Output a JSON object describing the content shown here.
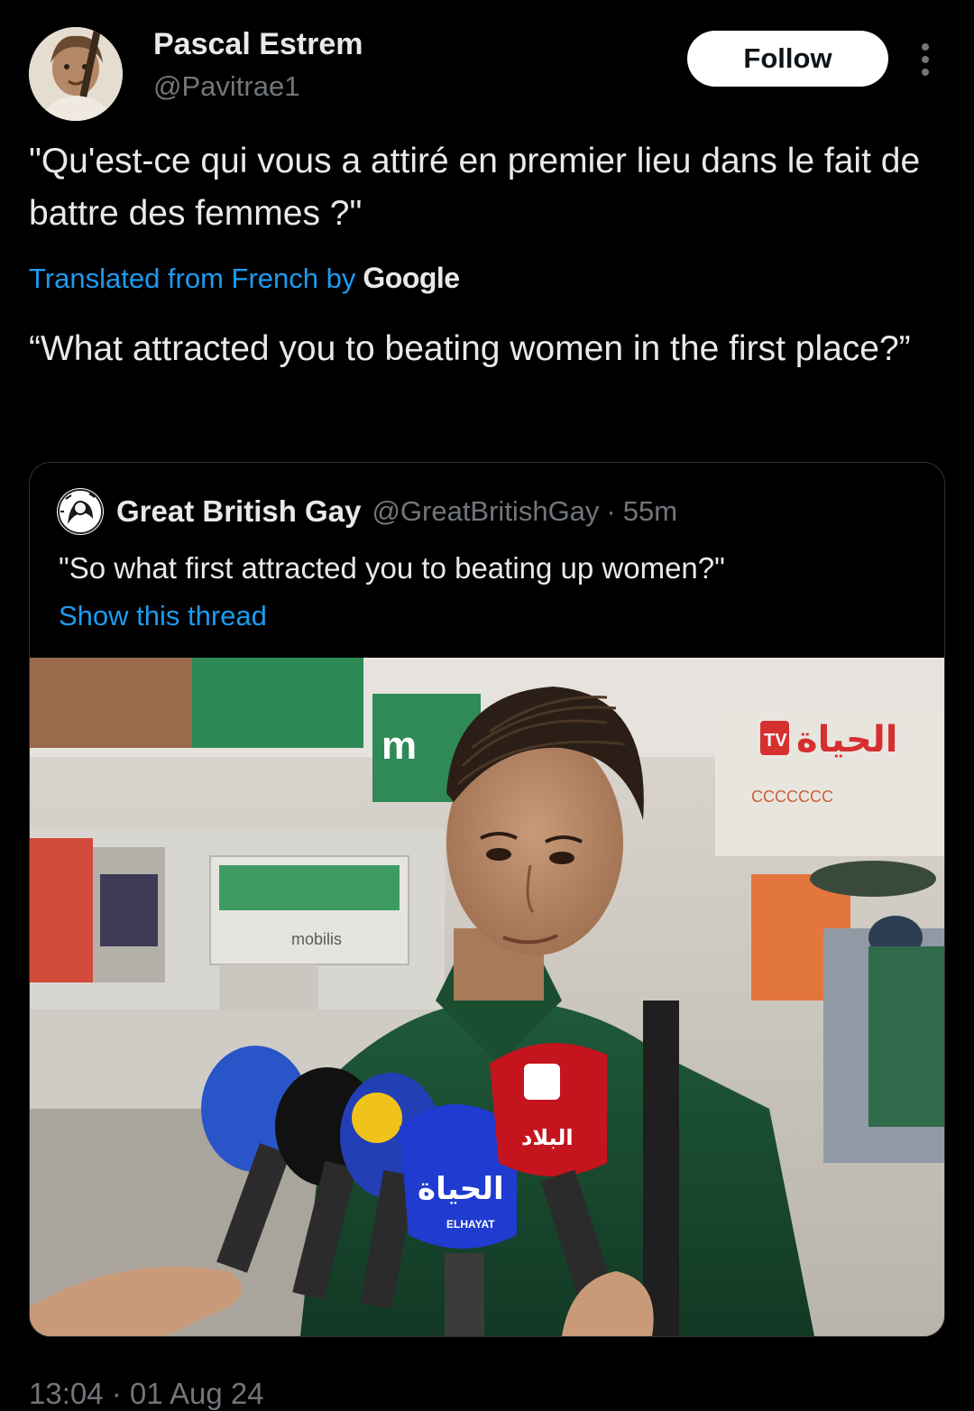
{
  "author": {
    "name": "Pascal Estrem",
    "handle": "@Pavitrae1",
    "avatar_icon": "profile-photo"
  },
  "follow_label": "Follow",
  "more_icon": "more-vertical-icon",
  "tweet": {
    "text": "\"Qu'est-ce qui vous a attiré en premier lieu dans le fait de battre des femmes ?\"",
    "translated_from": "Translated from French by",
    "translator": "Google",
    "translated_text": "“What attracted you to beating women in the first place?”"
  },
  "quoted": {
    "name": "Great British Gay",
    "handle": "@GreatBritishGay",
    "dot": "·",
    "time": "55m",
    "text": "\"So what first attracted you to beating up women?\"",
    "show_thread": "Show this thread",
    "media_signs": {
      "mic_channel": "الحياة",
      "mic_channel_latin": "ELHAYAT",
      "mic_red": "البلاد",
      "store_sign": "mobilis",
      "tv_logo": "TV",
      "tv_brand": "الحياة",
      "gate_sign": "CCCCCCC"
    }
  },
  "timestamp": "13:04 · 01 Aug 24",
  "colors": {
    "background": "#000000",
    "text_primary": "#e7e9ea",
    "text_secondary": "#71767b",
    "link": "#1d9bf0",
    "border": "#2f3336"
  }
}
